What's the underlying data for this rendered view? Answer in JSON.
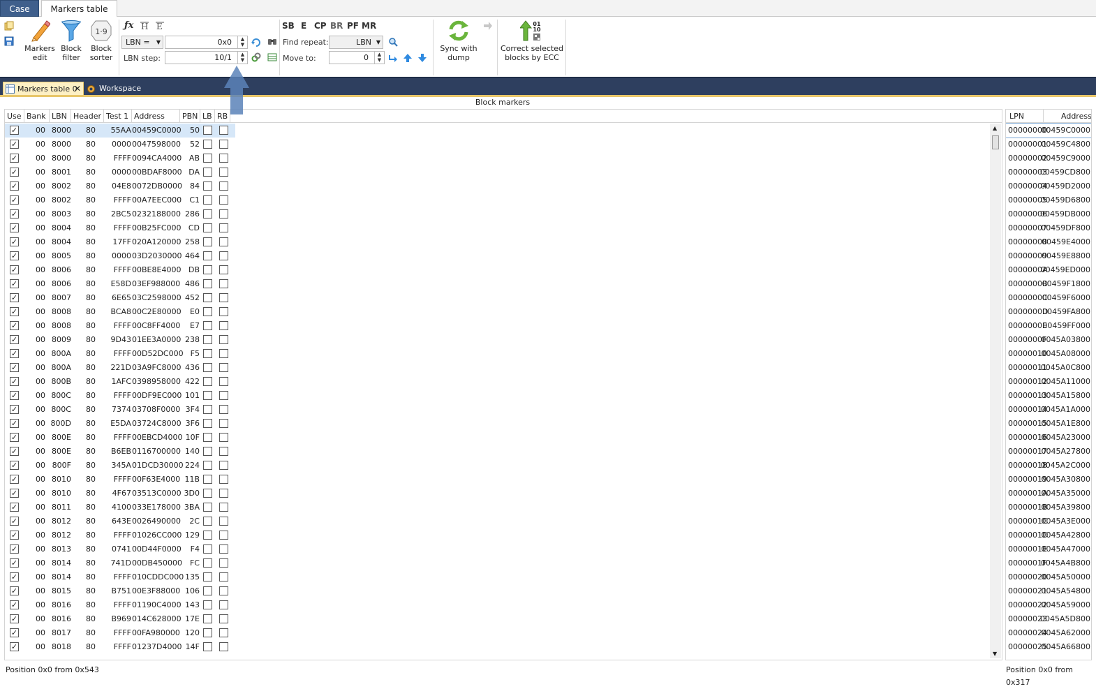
{
  "top_tabs": [
    "Case",
    "Markers table"
  ],
  "ribbon": {
    "markers_edit": "Markers\nedit",
    "block_filter": "Block\nfilter",
    "block_sorter": "Block\nsorter",
    "block_sorter_icon_text": "1·9",
    "lbn_combo": "LBN =",
    "lbn_value": "0x0",
    "lbn_step_label": "LBN step:",
    "lbn_step_value": "10/1",
    "format_labels": [
      "SB",
      "E",
      "CP",
      "BR",
      "PF",
      "MR"
    ],
    "find_repeat_label": "Find repeat:",
    "find_repeat_combo": "LBN",
    "move_to_label": "Move to:",
    "move_to_value": "0",
    "sync_label": "Sync with\ndump",
    "correct_label": "Correct selected\nblocks by ECC",
    "correct_icon_text": "01\n10"
  },
  "doc_tabs": {
    "markers": "Markers table 0",
    "workspace": "Workspace"
  },
  "group_header": "Block markers",
  "columns": [
    "Use",
    "Bank",
    "LBN",
    "Header",
    "Test 1",
    "Address",
    "PBN",
    "LB",
    "RB"
  ],
  "rows": [
    [
      "00",
      "8000",
      "80",
      "55AA",
      "00459C0000",
      "50"
    ],
    [
      "00",
      "8000",
      "80",
      "0000",
      "0047598000",
      "52"
    ],
    [
      "00",
      "8000",
      "80",
      "FFFF",
      "0094CA4000",
      "AB"
    ],
    [
      "00",
      "8001",
      "80",
      "0000",
      "00BDAF8000",
      "DA"
    ],
    [
      "00",
      "8002",
      "80",
      "04E8",
      "0072DB0000",
      "84"
    ],
    [
      "00",
      "8002",
      "80",
      "FFFF",
      "00A7EEC000",
      "C1"
    ],
    [
      "00",
      "8003",
      "80",
      "2BC5",
      "0232188000",
      "286"
    ],
    [
      "00",
      "8004",
      "80",
      "FFFF",
      "00B25FC000",
      "CD"
    ],
    [
      "00",
      "8004",
      "80",
      "17FF",
      "020A120000",
      "258"
    ],
    [
      "00",
      "8005",
      "80",
      "0000",
      "03D2030000",
      "464"
    ],
    [
      "00",
      "8006",
      "80",
      "FFFF",
      "00BE8E4000",
      "DB"
    ],
    [
      "00",
      "8006",
      "80",
      "E58D",
      "03EF988000",
      "486"
    ],
    [
      "00",
      "8007",
      "80",
      "6E65",
      "03C2598000",
      "452"
    ],
    [
      "00",
      "8008",
      "80",
      "BCA8",
      "00C2E80000",
      "E0"
    ],
    [
      "00",
      "8008",
      "80",
      "FFFF",
      "00C8FF4000",
      "E7"
    ],
    [
      "00",
      "8009",
      "80",
      "9D43",
      "01EE3A0000",
      "238"
    ],
    [
      "00",
      "800A",
      "80",
      "FFFF",
      "00D52DC000",
      "F5"
    ],
    [
      "00",
      "800A",
      "80",
      "221D",
      "03A9FC8000",
      "436"
    ],
    [
      "00",
      "800B",
      "80",
      "1AFC",
      "0398958000",
      "422"
    ],
    [
      "00",
      "800C",
      "80",
      "FFFF",
      "00DF9EC000",
      "101"
    ],
    [
      "00",
      "800C",
      "80",
      "7374",
      "03708F0000",
      "3F4"
    ],
    [
      "00",
      "800D",
      "80",
      "E5DA",
      "03724C8000",
      "3F6"
    ],
    [
      "00",
      "800E",
      "80",
      "FFFF",
      "00EBCD4000",
      "10F"
    ],
    [
      "00",
      "800E",
      "80",
      "B6EB",
      "0116700000",
      "140"
    ],
    [
      "00",
      "800F",
      "80",
      "345A",
      "01DCD30000",
      "224"
    ],
    [
      "00",
      "8010",
      "80",
      "FFFF",
      "00F63E4000",
      "11B"
    ],
    [
      "00",
      "8010",
      "80",
      "4F67",
      "03513C0000",
      "3D0"
    ],
    [
      "00",
      "8011",
      "80",
      "4100",
      "033E178000",
      "3BA"
    ],
    [
      "00",
      "8012",
      "80",
      "643E",
      "0026490000",
      "2C"
    ],
    [
      "00",
      "8012",
      "80",
      "FFFF",
      "01026CC000",
      "129"
    ],
    [
      "00",
      "8013",
      "80",
      "0741",
      "00D44F0000",
      "F4"
    ],
    [
      "00",
      "8014",
      "80",
      "741D",
      "00DB450000",
      "FC"
    ],
    [
      "00",
      "8014",
      "80",
      "FFFF",
      "010CDDC000",
      "135"
    ],
    [
      "00",
      "8015",
      "80",
      "B751",
      "00E3F88000",
      "106"
    ],
    [
      "00",
      "8016",
      "80",
      "FFFF",
      "01190C4000",
      "143"
    ],
    [
      "00",
      "8016",
      "80",
      "B969",
      "014C628000",
      "17E"
    ],
    [
      "00",
      "8017",
      "80",
      "FFFF",
      "00FA980000",
      "120"
    ],
    [
      "00",
      "8018",
      "80",
      "FFFF",
      "01237D4000",
      "14F"
    ]
  ],
  "lpn_columns": [
    "LPN",
    "Address"
  ],
  "lpn_rows": [
    [
      "00000000",
      "00459C0000"
    ],
    [
      "00000001",
      "00459C4800"
    ],
    [
      "00000002",
      "00459C9000"
    ],
    [
      "00000003",
      "00459CD800"
    ],
    [
      "00000004",
      "00459D2000"
    ],
    [
      "00000005",
      "00459D6800"
    ],
    [
      "00000006",
      "00459DB000"
    ],
    [
      "00000007",
      "00459DF800"
    ],
    [
      "00000008",
      "00459E4000"
    ],
    [
      "00000009",
      "00459E8800"
    ],
    [
      "0000000A",
      "00459ED000"
    ],
    [
      "0000000B",
      "00459F1800"
    ],
    [
      "0000000C",
      "00459F6000"
    ],
    [
      "0000000D",
      "00459FA800"
    ],
    [
      "0000000E",
      "00459FF000"
    ],
    [
      "0000000F",
      "0045A03800"
    ],
    [
      "00000010",
      "0045A08000"
    ],
    [
      "00000011",
      "0045A0C800"
    ],
    [
      "00000012",
      "0045A11000"
    ],
    [
      "00000013",
      "0045A15800"
    ],
    [
      "00000014",
      "0045A1A000"
    ],
    [
      "00000015",
      "0045A1E800"
    ],
    [
      "00000016",
      "0045A23000"
    ],
    [
      "00000017",
      "0045A27800"
    ],
    [
      "00000018",
      "0045A2C000"
    ],
    [
      "00000019",
      "0045A30800"
    ],
    [
      "0000001A",
      "0045A35000"
    ],
    [
      "0000001B",
      "0045A39800"
    ],
    [
      "0000001C",
      "0045A3E000"
    ],
    [
      "0000001D",
      "0045A42800"
    ],
    [
      "0000001E",
      "0045A47000"
    ],
    [
      "0000001F",
      "0045A4B800"
    ],
    [
      "00000020",
      "0045A50000"
    ],
    [
      "00000021",
      "0045A54800"
    ],
    [
      "00000022",
      "0045A59000"
    ],
    [
      "00000023",
      "0045A5D800"
    ],
    [
      "00000024",
      "0045A62000"
    ],
    [
      "00000025",
      "0045A66800"
    ]
  ],
  "status_left": "Position 0x0 from 0x543",
  "status_right": "Position 0x0 from 0x317",
  "colors": {
    "accent": "#2e3f5f",
    "tab_active": "#fdf0c4",
    "selection": "#d6e7f8",
    "case_tab": "#3f5f8c"
  }
}
